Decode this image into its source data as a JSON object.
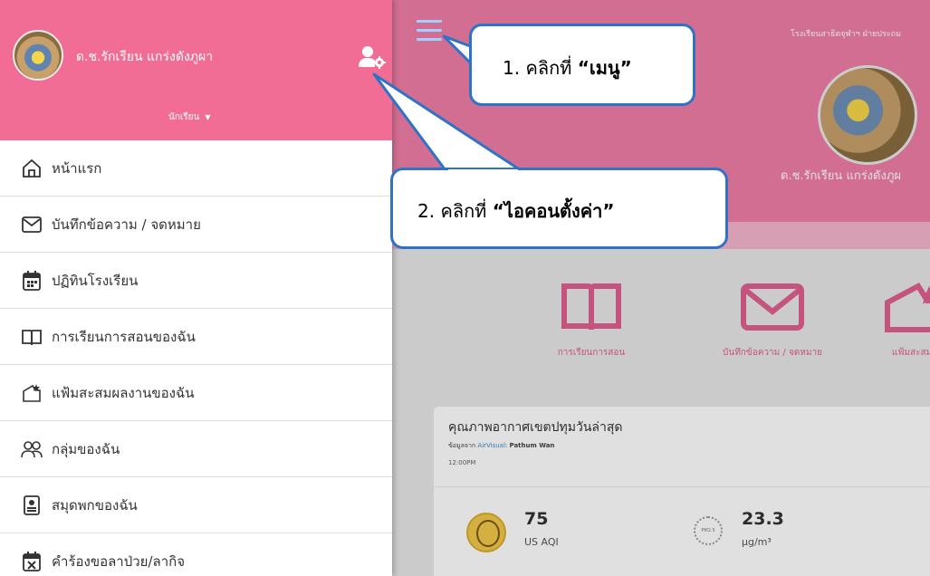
{
  "header": {
    "school_name": "โรงเรียนสาธิตจุฬาฯ ฝ่ายประถม",
    "user_name_display": "ด.ช.รักเรียน แกร่งดังภูผา",
    "hero_name": "ด.ช.รักเรียน แกร่งดังภูผ",
    "role": "นักเรียน"
  },
  "drawer": {
    "items": [
      {
        "label": "หน้าแรก",
        "icon": "home-icon"
      },
      {
        "label": "บันทึกข้อความ / จดหมาย",
        "icon": "envelope-icon"
      },
      {
        "label": "ปฏิทินโรงเรียน",
        "icon": "calendar-icon"
      },
      {
        "label": "การเรียนการสอนของฉัน",
        "icon": "book-icon"
      },
      {
        "label": "แฟ้มสะสมผลงานของฉัน",
        "icon": "portfolio-icon"
      },
      {
        "label": "กลุ่มของฉัน",
        "icon": "group-icon"
      },
      {
        "label": "สมุดพกของฉัน",
        "icon": "id-card-icon"
      },
      {
        "label": "คำร้องขอลาป่วย/ลากิจ",
        "icon": "calendar-x-icon"
      }
    ]
  },
  "quick_links": [
    {
      "label": "การเรียนการสอน",
      "icon": "book-icon"
    },
    {
      "label": "บันทึกข้อความ / จดหมาย",
      "icon": "envelope-icon"
    },
    {
      "label": "แฟ้มสะสมผ",
      "icon": "portfolio-icon"
    }
  ],
  "air_quality": {
    "title": "คุณภาพอากาศเขตปทุมวันล่าสุด",
    "source_prefix": "ข้อมูลจาก",
    "source_name": "AirVisual",
    "location": "Pathum Wan",
    "time": "12:00PM",
    "aqi_value": "75",
    "aqi_unit": "US AQI",
    "pm_badge": "PM2.5",
    "pm_value": "23.3",
    "pm_unit": "µg/m³"
  },
  "callouts": {
    "menu": {
      "prefix": "1. คลิกที่ ",
      "target": "“เมนู”"
    },
    "settings": {
      "prefix": "2. คลิกที่ ",
      "target": "“ไอคอนตั้งค่า”"
    }
  },
  "colors": {
    "brand_pink": "#f26d96",
    "callout_border": "#2e73c7"
  }
}
